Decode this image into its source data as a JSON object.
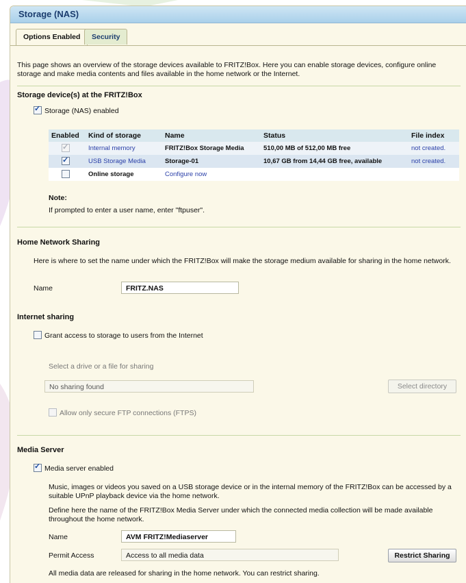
{
  "window": {
    "title": "Storage (NAS)"
  },
  "tabs": [
    {
      "label": "Options Enabled"
    },
    {
      "label": "Security"
    }
  ],
  "intro": "This page shows an overview of the storage devices available to FRITZ!Box. Here you can enable storage devices, configure online storage and make media contents and files available in the home network or the Internet.",
  "storage": {
    "heading": "Storage device(s) at the FRITZ!Box",
    "nas_enabled_label": "Storage (NAS) enabled",
    "nas_enabled": true,
    "columns": [
      "Enabled",
      "Kind of storage",
      "Name",
      "Status",
      "File index"
    ],
    "rows": [
      {
        "enabled": true,
        "dim": true,
        "kind": "Internal memory",
        "name": "FRITZ!Box Storage Media",
        "status": "510,00 MB of 512,00 MB free",
        "index": "not created."
      },
      {
        "enabled": true,
        "dim": false,
        "kind": "USB Storage Media",
        "name": "Storage-01",
        "status": "10,67 GB from 14,44 GB free, available",
        "index": "not created."
      },
      {
        "enabled": false,
        "dim": false,
        "kind": "Online storage",
        "name": "Configure now",
        "status": "",
        "index": ""
      }
    ],
    "note_label": "Note:",
    "note_text": "If prompted to enter a user name, enter \"ftpuser\"."
  },
  "home_sharing": {
    "heading": "Home Network Sharing",
    "desc": "Here is where to set the name under which the FRITZ!Box will make the storage medium available for sharing in the home network.",
    "name_label": "Name",
    "name_value": "FRITZ.NAS"
  },
  "internet_sharing": {
    "heading": "Internet sharing",
    "grant_label": "Grant access to storage to users from the Internet",
    "grant_checked": false,
    "select_hint": "Select a drive or a file for sharing",
    "path_value": "No sharing found",
    "select_button": "Select directory",
    "ftps_label": "Allow only secure FTP connections (FTPS)",
    "ftps_checked": false
  },
  "media_server": {
    "heading": "Media Server",
    "enabled_label": "Media server enabled",
    "enabled": true,
    "desc1": "Music, images or videos you saved on a USB storage device or in the internal memory of the FRITZ!Box can be accessed by a suitable UPnP playback device via the home network.",
    "desc2": "Define here the name of the FRITZ!Box Media Server under which the connected media collection will be made available throughout the home network.",
    "name_label": "Name",
    "name_value": "AVM FRITZ!Mediaserver",
    "permit_label": "Permit Access",
    "permit_value": "Access to all media data",
    "restrict_button": "Restrict Sharing",
    "footer": "All media data are released for sharing in the home network. You can restrict sharing."
  },
  "colors": {
    "accent": "#1a3c6e",
    "link": "#2a3fa8",
    "panel": "#fbf8e8",
    "titlebar": "#a9d0ea"
  }
}
